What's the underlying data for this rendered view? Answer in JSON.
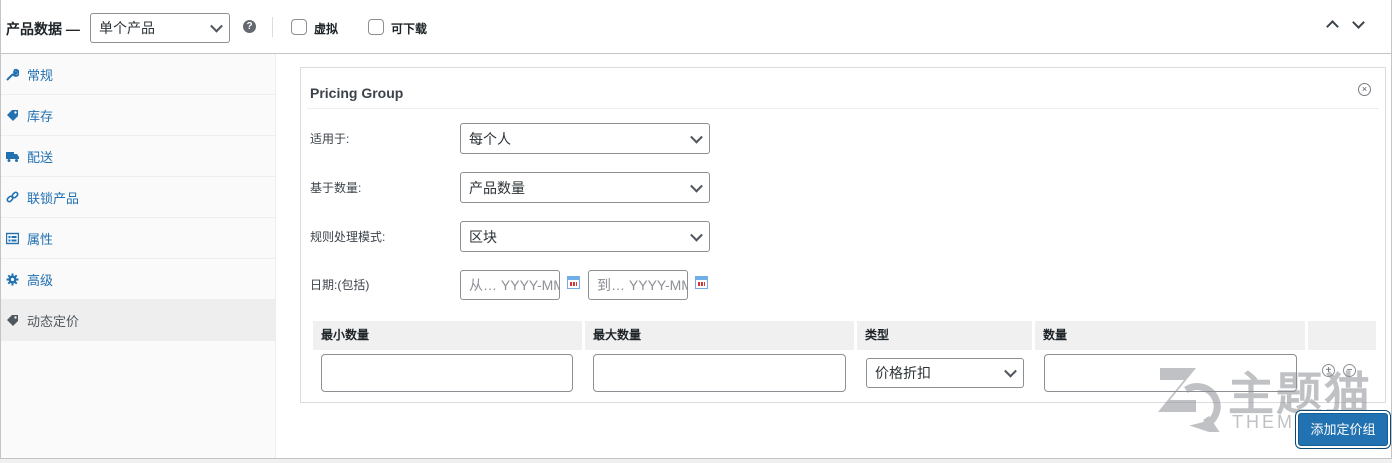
{
  "header": {
    "title": "产品数据 —",
    "product_type": "单个产品",
    "help": "?",
    "virtual_label": "虚拟",
    "downloadable_label": "可下载"
  },
  "sidebar": {
    "items": [
      {
        "label": "常规",
        "icon": "wrench-icon"
      },
      {
        "label": "库存",
        "icon": "tag-icon"
      },
      {
        "label": "配送",
        "icon": "truck-icon"
      },
      {
        "label": "联锁产品",
        "icon": "link-icon"
      },
      {
        "label": "属性",
        "icon": "list-icon"
      },
      {
        "label": "高级",
        "icon": "gear-icon"
      },
      {
        "label": "动态定价",
        "icon": "price-tag-icon"
      }
    ],
    "active_index": 6
  },
  "pricing_group": {
    "title": "Pricing Group",
    "close": "×",
    "applies_to_label": "适用于:",
    "applies_to_value": "每个人",
    "quantity_based_label": "基于数量:",
    "quantity_based_value": "产品数量",
    "rule_mode_label": "规则处理模式:",
    "rule_mode_value": "区块",
    "dates_label": "日期:(包括)",
    "date_from_placeholder": "从… YYYY-MM-DD",
    "date_to_placeholder": "到… YYYY-MM-DD",
    "table": {
      "headers": [
        "最小数量",
        "最大数量",
        "类型",
        "数量"
      ],
      "type_value": "价格折扣",
      "add_row": "+",
      "remove_row": "−"
    }
  },
  "add_group_button": "添加定价组",
  "watermark": {
    "main": "主题猫",
    "sub": "THEME"
  },
  "colors": {
    "link": "#2271b1",
    "button": "#2271b1",
    "border": "#c3c4c7"
  }
}
